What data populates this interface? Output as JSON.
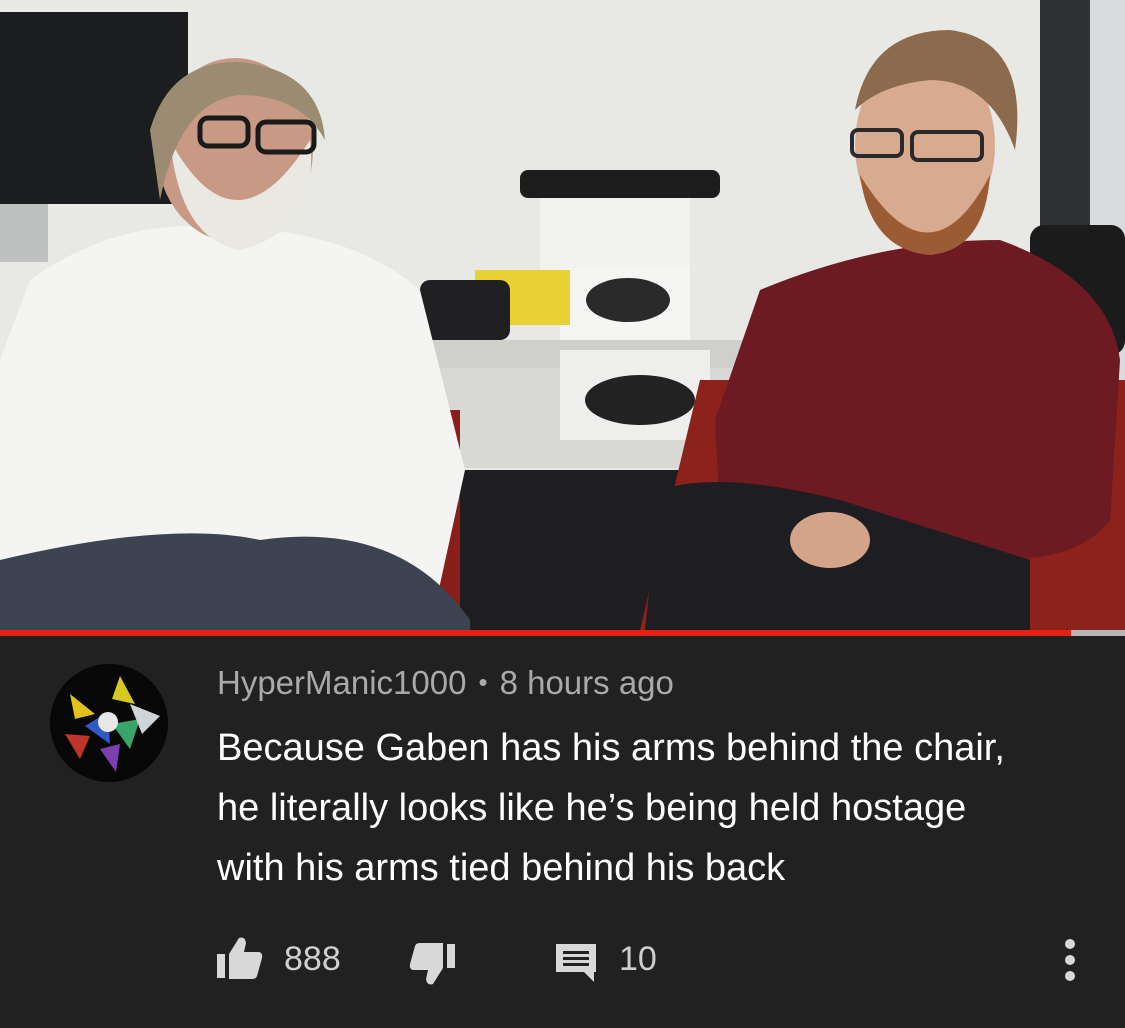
{
  "video": {
    "progress": 0.952,
    "buffered": 1.0,
    "colors": {
      "played": "#e52212",
      "buffered": "#b5b5b5"
    }
  },
  "comment": {
    "author": "HyperManic1000",
    "separator": "•",
    "timestamp": "8 hours ago",
    "text_lines": [
      "Because Gaben has his arms behind the chair,",
      "he literally looks like he’s being held hostage",
      "with his arms tied behind his back"
    ],
    "likes": "888",
    "replies": "10",
    "icons": {
      "like": "thumbs-up-icon",
      "dislike": "thumbs-down-icon",
      "reply": "comment-icon",
      "menu": "more-vertical-icon"
    }
  }
}
